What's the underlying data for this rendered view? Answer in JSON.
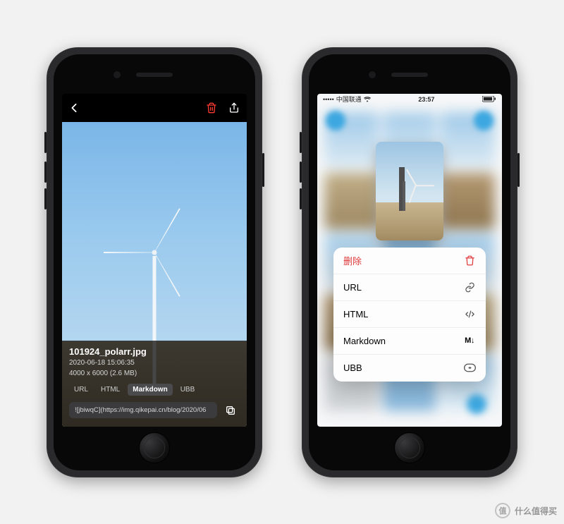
{
  "left": {
    "filename": "101924_polarr.jpg",
    "timestamp": "2020-06-18 15:06:35",
    "dimensions": "4000 x 6000 (2.6 MB)",
    "formats": {
      "url": "URL",
      "html": "HTML",
      "markdown": "Markdown",
      "ubb": "UBB"
    },
    "link": "![jbiwqC](https://img.qikepai.cn/blog/2020/06"
  },
  "right": {
    "status": {
      "carrier": "中国联通",
      "time": "23:57"
    },
    "menu": {
      "delete": "删除",
      "url": "URL",
      "html": "HTML",
      "markdown": "Markdown",
      "markdown_badge": "M↓",
      "ubb": "UBB"
    }
  },
  "watermark": {
    "badge": "值",
    "text": "什么值得买"
  }
}
